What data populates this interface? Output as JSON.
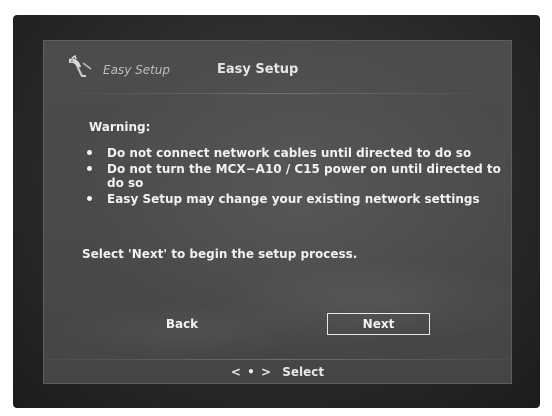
{
  "header": {
    "brand": "Easy Setup",
    "title": "Easy Setup",
    "logo_icon": "satellite-dish-icon"
  },
  "content": {
    "warning_label": "Warning:",
    "bullets": [
      "Do not connect network cables until directed to do so",
      "Do not turn the MCX−A10 / C15 power on until directed to do so",
      "Easy Setup may change your existing network settings"
    ],
    "instruction": "Select 'Next' to begin the setup process."
  },
  "buttons": {
    "back": "Back",
    "next": "Next"
  },
  "footer": {
    "nav_hint_icon": "left-dot-right-arrows-icon",
    "arrows": "< • >",
    "hint": "Select"
  }
}
